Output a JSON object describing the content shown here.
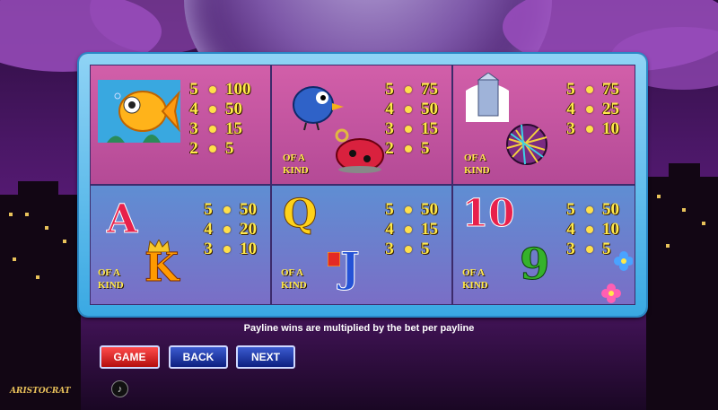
{
  "paytable": {
    "of_a_kind": "OF A\nKIND",
    "cells": [
      {
        "symbol": "goldfish",
        "pays": [
          [
            "5",
            "100"
          ],
          [
            "4",
            "50"
          ],
          [
            "3",
            "15"
          ],
          [
            "2",
            "5"
          ]
        ]
      },
      {
        "symbol": "bluebird-and-ladybug",
        "pays": [
          [
            "5",
            "75"
          ],
          [
            "4",
            "50"
          ],
          [
            "3",
            "15"
          ],
          [
            "2",
            "5"
          ]
        ]
      },
      {
        "symbol": "milk-carton-and-yarn-ball",
        "pays": [
          [
            "5",
            "75"
          ],
          [
            "4",
            "25"
          ],
          [
            "3",
            "10"
          ]
        ]
      },
      {
        "symbol": "letters-A-K",
        "letters": [
          "A",
          "K"
        ],
        "pays": [
          [
            "5",
            "50"
          ],
          [
            "4",
            "20"
          ],
          [
            "3",
            "10"
          ]
        ]
      },
      {
        "symbol": "letters-Q-J",
        "letters": [
          "Q",
          "J"
        ],
        "pays": [
          [
            "5",
            "50"
          ],
          [
            "4",
            "15"
          ],
          [
            "3",
            "5"
          ]
        ]
      },
      {
        "symbol": "numbers-10-9",
        "letters": [
          "10",
          "9"
        ],
        "pays": [
          [
            "5",
            "50"
          ],
          [
            "4",
            "10"
          ],
          [
            "3",
            "5"
          ]
        ]
      }
    ]
  },
  "note": "Payline wins are multiplied by the bet per payline",
  "buttons": {
    "game": "GAME",
    "back": "BACK",
    "next": "NEXT"
  },
  "logo": "ARISTOCRAT",
  "colors": {
    "pay_text": "#ffe94a",
    "top_row": "#c6539e",
    "bottom_row": "#6a7ecb",
    "frame": "#3aa9e3"
  }
}
